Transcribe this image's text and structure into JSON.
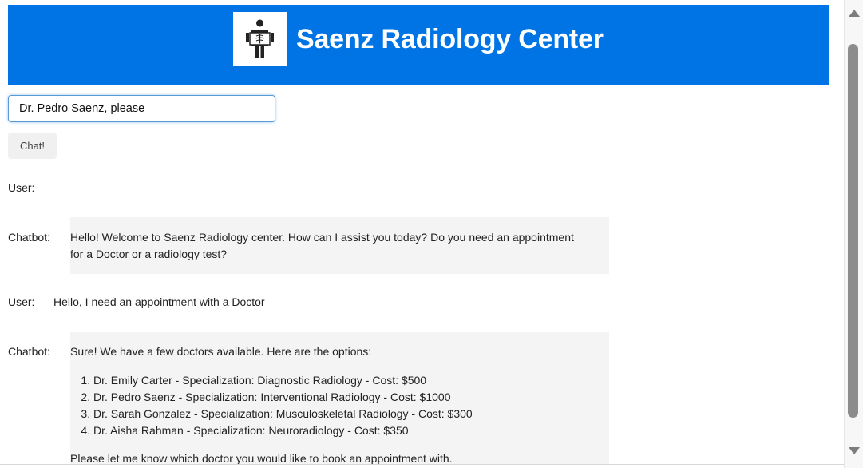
{
  "header": {
    "title": "Saenz Radiology Center",
    "logo_icon": "xray-person-icon",
    "background_color": "#0074e4"
  },
  "input": {
    "value": "Dr. Pedro Saenz, please"
  },
  "chat_button": {
    "label": "Chat!"
  },
  "messages": [
    {
      "speaker": "User:",
      "text": ""
    },
    {
      "speaker": "Chatbot:",
      "lines": [
        "Hello! Welcome to Saenz Radiology center. How can I assist you today? Do you need an appointment",
        "for a Doctor or a radiology test?"
      ]
    },
    {
      "speaker": "User:",
      "text": "Hello, I need an appointment with a Doctor"
    },
    {
      "speaker": "Chatbot:",
      "intro": "Sure! We have a few doctors available. Here are the options:",
      "options": [
        "Dr. Emily Carter - Specialization: Diagnostic Radiology - Cost: $500",
        "Dr. Pedro Saenz - Specialization: Interventional Radiology - Cost: $1000",
        "Dr. Sarah Gonzalez - Specialization: Musculoskeletal Radiology - Cost: $300",
        "Dr. Aisha Rahman - Specialization: Neuroradiology - Cost: $350"
      ],
      "outro": "Please let me know which doctor you would like to book an appointment with."
    }
  ]
}
